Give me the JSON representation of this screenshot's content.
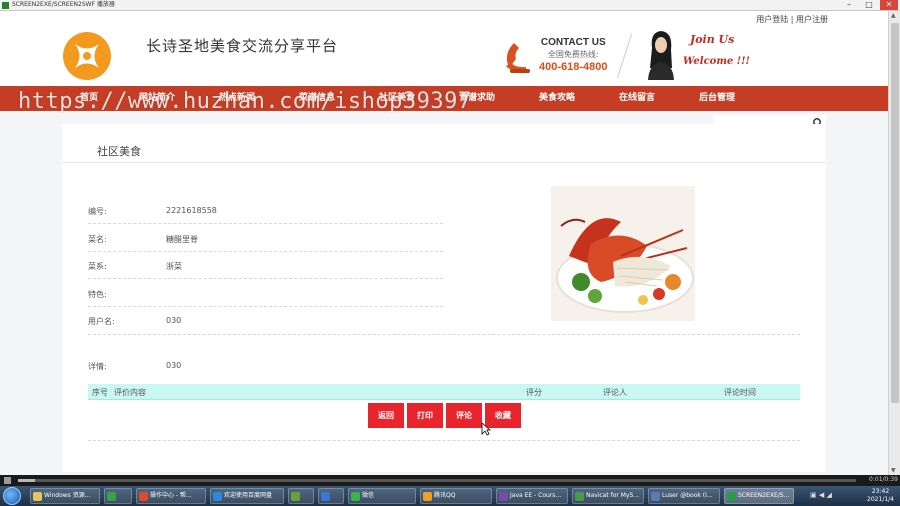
{
  "window": {
    "title": "SCREEN2EXE/SCREEN2SWF 播放器",
    "min": "–",
    "max": "□",
    "close": "✕"
  },
  "header": {
    "top_links": {
      "login": "用户登陆",
      "sep": " | ",
      "register": "用户注册"
    },
    "site_title": "长诗圣地美食交流分享平台",
    "contact_title": "CONTACT US",
    "contact_sub": "全国免费热线:",
    "phone": "400-618-4800",
    "join": "Join Us",
    "welcome": "Welcome !!!"
  },
  "nav": {
    "items": [
      "首页",
      "网站简介",
      "热点新闻",
      "菜谱信息",
      "社区美食",
      "食谱求助",
      "美食攻略",
      "在线留言",
      "后台管理"
    ]
  },
  "watermark": "https://www.huzhan.com/ishop39397",
  "section": {
    "title": "社区美食"
  },
  "detail": {
    "fields": [
      {
        "label": "编号:",
        "value": "2221618558"
      },
      {
        "label": "菜名:",
        "value": "糖醋里脊"
      },
      {
        "label": "菜系:",
        "value": "浙菜"
      },
      {
        "label": "特色:",
        "value": ""
      },
      {
        "label": "用户名:",
        "value": "030"
      }
    ],
    "desc_label": "详情:",
    "desc_value": "030"
  },
  "comments_table": {
    "headers": [
      "序号",
      "评价内容",
      "评分",
      "评论人",
      "评论时间"
    ]
  },
  "buttons": {
    "back": "返回",
    "print": "打印",
    "comment": "评论",
    "favorite": "收藏"
  },
  "player": {
    "time": "0:01/0:39",
    "progress": 0.02
  },
  "taskbar": {
    "tasks": [
      "Windows 资源...",
      "",
      "操作中心 - 帮...",
      "欢迎使用百度网盘",
      "",
      "",
      "微信",
      "腾讯QQ",
      "Java EE - Cours...",
      "Navicat for MyS...",
      "Luser @book (I...",
      "SCREEN2EXE/S..."
    ],
    "time": "23:42",
    "date": "2021/1/4"
  },
  "colors": {
    "nav": "#c43d24",
    "button": "#e8242c",
    "table_head": "#c9f7f4",
    "accent": "#e04b1a"
  }
}
